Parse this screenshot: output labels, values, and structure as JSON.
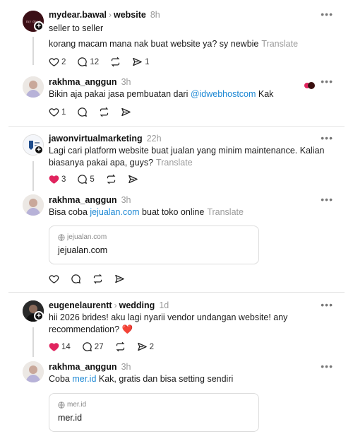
{
  "posts": [
    {
      "username": "mydear.bawal",
      "topic": "website",
      "time": "8h",
      "line1": "seller to seller",
      "line2": "korang macam mana nak buat website ya? sy newbie",
      "translate": "Translate",
      "likes": "2",
      "replies": "12",
      "shares": "1"
    },
    {
      "username": "rakhma_anggun",
      "time": "3h",
      "text_before": "Bikin aja pakai jasa pembuatan dari ",
      "mention": "@idwebhostcom",
      "text_after": " Kak",
      "likes": "1"
    },
    {
      "username": "jawonvirtualmarketing",
      "time": "22h",
      "text": "Lagi cari platform website buat jualan yang minim maintenance. Kalian biasanya pakai apa, guys?",
      "translate": "Translate",
      "likes": "3",
      "replies": "5"
    },
    {
      "username": "rakhma_anggun",
      "time": "3h",
      "text_before": "Bisa coba ",
      "link": "jejualan.com",
      "text_after": " buat toko online",
      "translate": "Translate",
      "card_domain": "jejualan.com",
      "card_title": "jejualan.com"
    },
    {
      "username": "eugenelaurentt",
      "topic": "wedding",
      "time": "1d",
      "text": "hii 2026 brides! aku lagi nyarii vendor undangan website! any recommendation?",
      "emoji": "❤️",
      "likes": "14",
      "replies": "27",
      "shares": "2"
    },
    {
      "username": "rakhma_anggun",
      "time": "3h",
      "text_before": "Coba ",
      "link": "mer.id",
      "text_after": " Kak, gratis dan bisa setting sendiri",
      "card_domain": "mer.id",
      "card_title": "mer.id"
    }
  ],
  "more_label": "•••",
  "colors": {
    "link": "#1d88d4",
    "like_active": "#e0245e",
    "muted": "#9a9a9a"
  }
}
